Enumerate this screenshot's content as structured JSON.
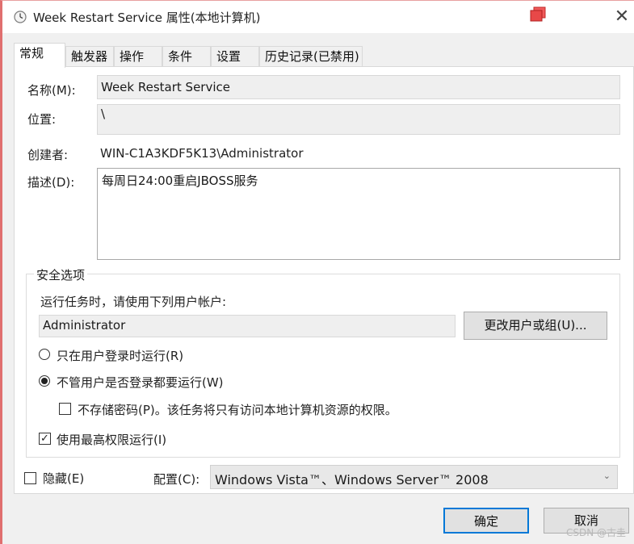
{
  "window": {
    "title": "Week Restart Service 属性(本地计算机)"
  },
  "tabs": [
    {
      "label": "常规"
    },
    {
      "label": "触发器"
    },
    {
      "label": "操作"
    },
    {
      "label": "条件"
    },
    {
      "label": "设置"
    },
    {
      "label": "历史记录(已禁用)"
    }
  ],
  "general": {
    "name_label": "名称(M):",
    "name_value": "Week Restart Service",
    "location_label": "位置:",
    "location_value": "\\",
    "author_label": "创建者:",
    "author_value": "WIN-C1A3KDF5K13\\Administrator",
    "description_label": "描述(D):",
    "description_value": "每周日24:00重启JBOSS服务"
  },
  "security": {
    "group_title": "安全选项",
    "run_as_prompt": "运行任务时，请使用下列用户帐户:",
    "user_account": "Administrator",
    "change_user_button": "更改用户或组(U)...",
    "option_logged_on": "只在用户登录时运行(R)",
    "option_whether_logged_on": "不管用户是否登录都要运行(W)",
    "do_not_store_password": "不存储密码(P)。该任务将只有访问本地计算机资源的权限。",
    "run_highest_privileges": "使用最高权限运行(I)",
    "selected_option": "whether_logged_on",
    "do_not_store_password_checked": false,
    "run_highest_privileges_checked": true
  },
  "footer": {
    "hidden_label": "隐藏(E)",
    "hidden_checked": false,
    "configure_label": "配置(C):",
    "configure_value": "Windows Vista™、Windows Server™ 2008",
    "ok_button": "确定",
    "cancel_button": "取消"
  },
  "watermark": "CSDN @古圭",
  "colors": {
    "window_border": "#e06f6f",
    "default_button_border": "#0078d7",
    "restore_icon": "#e03c3c"
  }
}
